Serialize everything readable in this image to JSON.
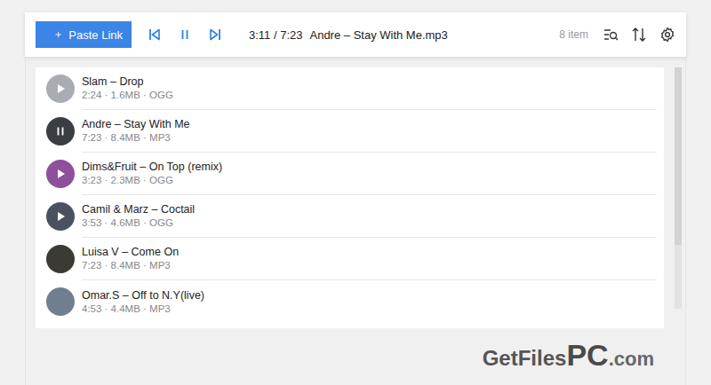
{
  "toolbar": {
    "paste_button": {
      "label": "Paste Link"
    },
    "now_playing": {
      "time": "3:11 / 7:23",
      "title": "Andre – Stay With Me.mp3"
    },
    "playing": true,
    "item_count": "8 item"
  },
  "tracks": [
    {
      "title": "Slam – Drop",
      "meta": "2:24 · 1.6MB · OGG",
      "playing": false,
      "show_button": true,
      "color": "#a9adb3"
    },
    {
      "title": "Andre – Stay With Me",
      "meta": "7:23 · 8.4MB · MP3",
      "playing": true,
      "show_button": true,
      "color": "#3a3d42"
    },
    {
      "title": "Dims&Fruit – On Top (remix)",
      "meta": "3:23 · 2.3MB · OGG",
      "playing": false,
      "show_button": true,
      "color": "#8e4f9c"
    },
    {
      "title": "Camil & Marz – Coctail",
      "meta": "3:53 · 4.6MB · OGG",
      "playing": false,
      "show_button": true,
      "color": "#4a5260"
    },
    {
      "title": "Luisa V – Come On",
      "meta": "7:23 · 8.4MB · MP3",
      "playing": false,
      "show_button": false,
      "color": "#3b3a34"
    },
    {
      "title": "Omar.S – Off to N.Y(live)",
      "meta": "4:53 · 4.4MB · MP3",
      "playing": false,
      "show_button": false,
      "color": "#6f7f8f"
    }
  ],
  "watermark": {
    "part1": "GetFiles",
    "part2": "PC",
    "part3": ".com"
  }
}
